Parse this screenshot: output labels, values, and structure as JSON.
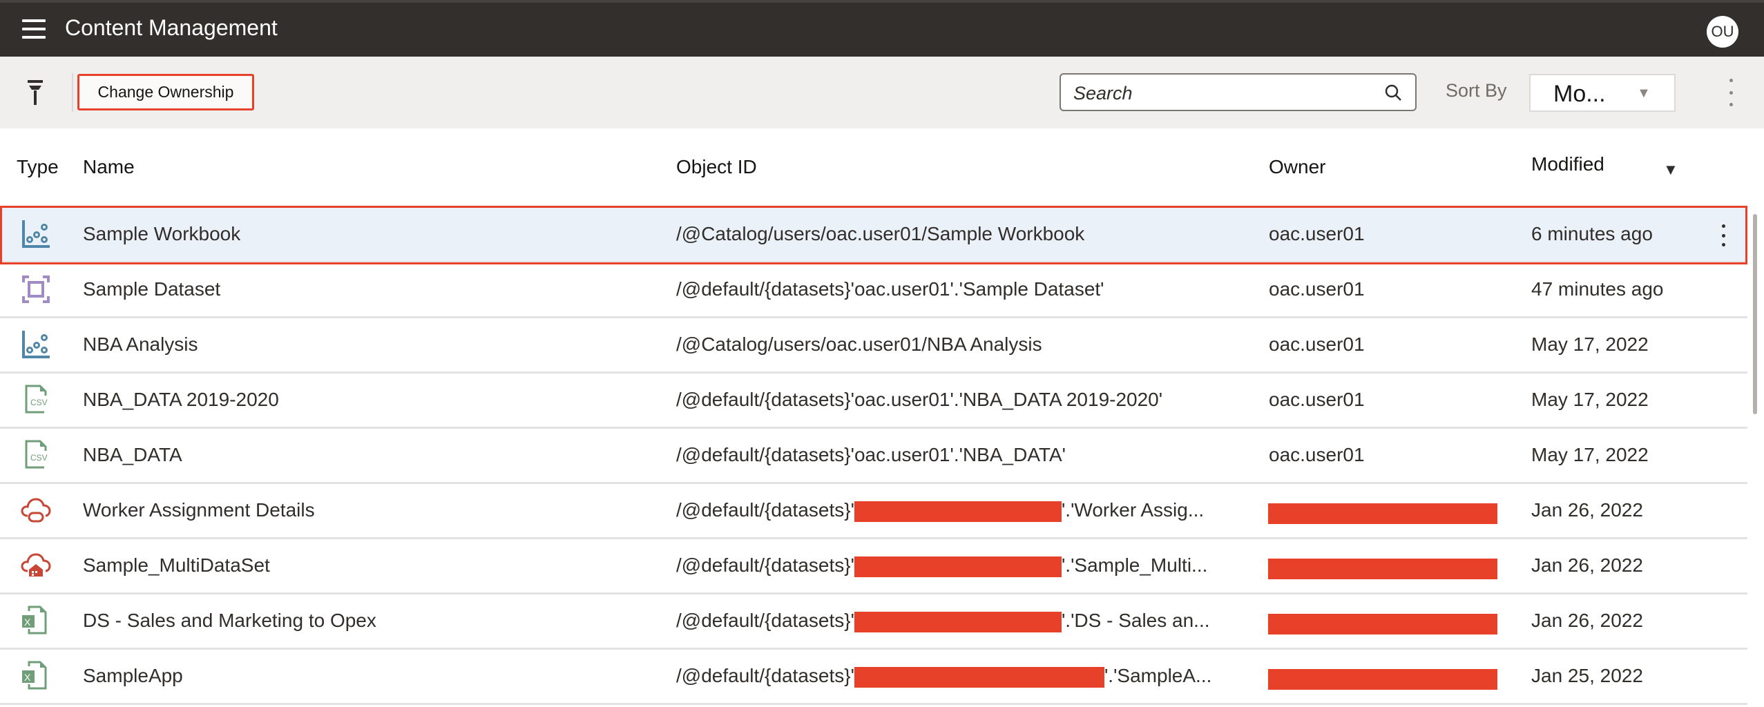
{
  "header": {
    "title": "Content Management",
    "avatar_initials": "OU"
  },
  "toolbar": {
    "change_ownership_label": "Change Ownership",
    "search_placeholder": "Search",
    "sort_by_label": "Sort By",
    "sort_by_value": "Mo..."
  },
  "columns": {
    "type": "Type",
    "name": "Name",
    "object_id": "Object ID",
    "owner": "Owner",
    "modified": "Modified"
  },
  "colors": {
    "accent_highlight": "#e8412a",
    "selected_row": "#eaf1f8",
    "topbar": "#322f2c"
  },
  "rows": [
    {
      "icon": "workbook-icon",
      "name": "Sample Workbook",
      "object_id": "/@Catalog/users/oac.user01/Sample Workbook",
      "owner": "oac.user01",
      "modified": "6 minutes ago",
      "selected": true
    },
    {
      "icon": "dataset-icon",
      "name": "Sample Dataset",
      "object_id": "/@default/{datasets}'oac.user01'.'Sample Dataset'",
      "owner": "oac.user01",
      "modified": "47 minutes ago"
    },
    {
      "icon": "workbook-icon",
      "name": "NBA Analysis",
      "object_id": "/@Catalog/users/oac.user01/NBA Analysis",
      "owner": "oac.user01",
      "modified": "May 17, 2022"
    },
    {
      "icon": "csv-file-icon",
      "name": "NBA_DATA 2019-2020",
      "object_id": "/@default/{datasets}'oac.user01'.'NBA_DATA 2019-2020'",
      "owner": "oac.user01",
      "modified": "May 17, 2022"
    },
    {
      "icon": "csv-file-icon",
      "name": "NBA_DATA",
      "object_id": "/@default/{datasets}'oac.user01'.'NBA_DATA'",
      "owner": "oac.user01",
      "modified": "May 17, 2022"
    },
    {
      "icon": "cloud-database-icon",
      "name": "Worker Assignment Details",
      "object_id_prefix": "/@default/{datasets}'",
      "object_id_suffix": "'.'Worker Assig...",
      "owner_redacted": true,
      "modified": "Jan 26, 2022"
    },
    {
      "icon": "cloud-warehouse-icon",
      "name": "Sample_MultiDataSet",
      "object_id_prefix": "/@default/{datasets}'",
      "object_id_suffix": "'.'Sample_Multi...",
      "owner_redacted": true,
      "modified": "Jan 26, 2022"
    },
    {
      "icon": "excel-file-icon",
      "name": "DS - Sales and Marketing to Opex",
      "object_id_prefix": "/@default/{datasets}'",
      "object_id_suffix": "'.'DS - Sales an...",
      "owner_redacted": true,
      "modified": "Jan 26, 2022"
    },
    {
      "icon": "excel-file-icon",
      "name": "SampleApp",
      "object_id_prefix": "/@default/{datasets}'",
      "object_id_suffix": "'.'SampleA...",
      "owner_redacted": true,
      "modified": "Jan 25, 2022"
    }
  ]
}
